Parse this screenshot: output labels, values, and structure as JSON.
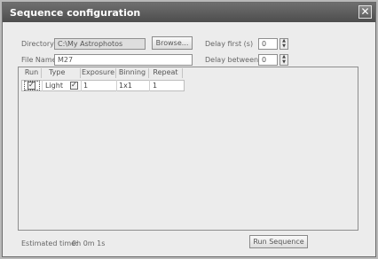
{
  "window": {
    "title": "Sequence configuration",
    "close_glyph": "✕"
  },
  "form": {
    "directory_label": "Directory",
    "directory_value": "C:\\My Astrophotos",
    "browse_label": "Browse...",
    "file_name_label": "File Name",
    "file_name_value": "M27",
    "delay_first_label": "Delay first (s)",
    "delay_first_value": "0",
    "delay_between_label": "Delay between (s)",
    "delay_between_value": "0"
  },
  "table": {
    "columns": [
      "Run",
      "Type",
      "Exposure",
      "Binning",
      "Repeat"
    ],
    "rows": [
      {
        "run_checked": true,
        "type": "Light",
        "type_checked": true,
        "exposure": "1",
        "binning": "1x1",
        "repeat": "1"
      }
    ],
    "check_glyph": "✓"
  },
  "footer": {
    "estimated_time_label": "Estimated time:",
    "estimated_time_value": "0h 0m 1s",
    "run_sequence_label": "Run Sequence"
  }
}
